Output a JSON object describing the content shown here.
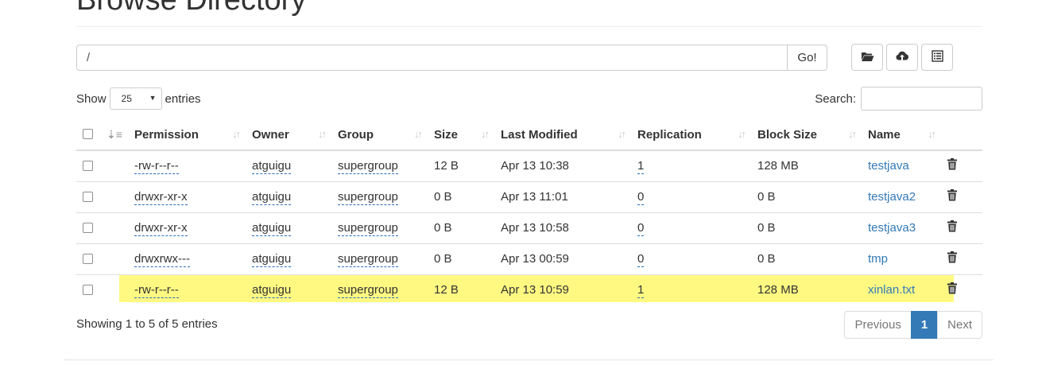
{
  "page_title": "Browse Directory",
  "path": {
    "value": "/",
    "go_label": "Go!"
  },
  "toolbar": {
    "create_dir_icon": "folder-open-icon",
    "upload_icon": "cloud-upload-icon",
    "cut_paste_icon": "list-icon"
  },
  "length": {
    "show_label": "Show",
    "value": "25",
    "entries_label": "entries"
  },
  "search": {
    "label": "Search:",
    "value": ""
  },
  "columns": [
    "Permission",
    "Owner",
    "Group",
    "Size",
    "Last Modified",
    "Replication",
    "Block Size",
    "Name"
  ],
  "rows": [
    {
      "permission": "-rw-r--r--",
      "owner": "atguigu",
      "group": "supergroup",
      "size": "12 B",
      "modified": "Apr 13 10:38",
      "replication": "1",
      "block_size": "128 MB",
      "name": "testjava"
    },
    {
      "permission": "drwxr-xr-x",
      "owner": "atguigu",
      "group": "supergroup",
      "size": "0 B",
      "modified": "Apr 13 11:01",
      "replication": "0",
      "block_size": "0 B",
      "name": "testjava2"
    },
    {
      "permission": "drwxr-xr-x",
      "owner": "atguigu",
      "group": "supergroup",
      "size": "0 B",
      "modified": "Apr 13 10:58",
      "replication": "0",
      "block_size": "0 B",
      "name": "testjava3"
    },
    {
      "permission": "drwxrwx---",
      "owner": "atguigu",
      "group": "supergroup",
      "size": "0 B",
      "modified": "Apr 13 00:59",
      "replication": "0",
      "block_size": "0 B",
      "name": "tmp"
    },
    {
      "permission": "-rw-r--r--",
      "owner": "atguigu",
      "group": "supergroup",
      "size": "12 B",
      "modified": "Apr 13 10:59",
      "replication": "1",
      "block_size": "128 MB",
      "name": "xinlan.txt"
    }
  ],
  "footer": {
    "info": "Showing 1 to 5 of 5 entries",
    "previous": "Previous",
    "current_page": "1",
    "next": "Next"
  },
  "colors": {
    "link": "#337ab7",
    "highlight": "#fff982",
    "active_page": "#337ab7"
  }
}
